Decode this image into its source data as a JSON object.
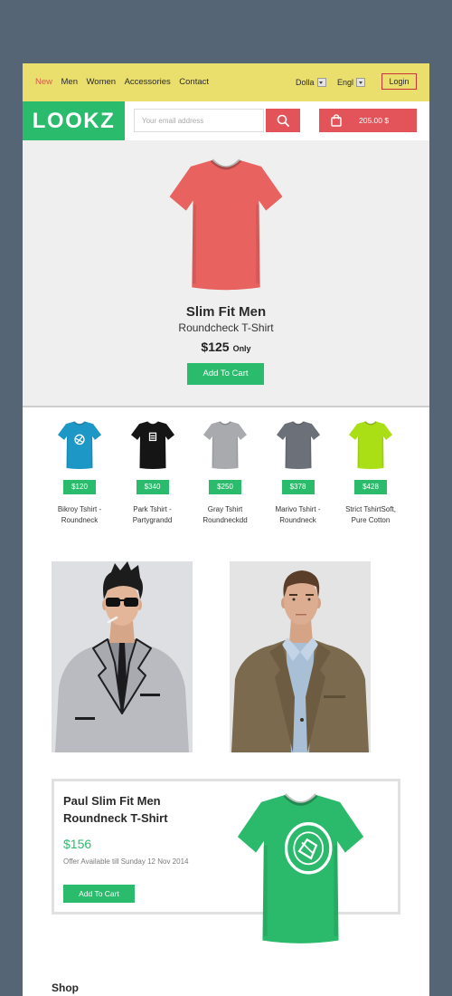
{
  "colors": {
    "page_background": "#566576",
    "nav_background": "#eadf6d",
    "brand_green": "#2bbb6c",
    "accent_red": "#e2535a",
    "nav_active": "#d9574f",
    "hero_background": "#efefef"
  },
  "nav": {
    "items": [
      {
        "label": "New",
        "active": true
      },
      {
        "label": "Men",
        "active": false
      },
      {
        "label": "Women",
        "active": false
      },
      {
        "label": "Accessories",
        "active": false
      },
      {
        "label": "Contact",
        "active": false
      }
    ],
    "currency": {
      "value": "Dolla",
      "icon": "chevron-down-icon"
    },
    "language": {
      "value": "Engl",
      "icon": "chevron-down-icon"
    },
    "login_label": "Login"
  },
  "header": {
    "logo_text": "LOOKZ",
    "email_placeholder": "Your email address",
    "search_icon": "search-icon",
    "cart": {
      "icon": "shopping-bag-icon",
      "total": "205.00 $"
    }
  },
  "hero": {
    "title": "Slim Fit Men",
    "subtitle": "Roundcheck T-Shirt",
    "price": "$125",
    "price_suffix": "Only",
    "button_label": "Add To Cart",
    "shirt_color": "#e8625f"
  },
  "products": [
    {
      "name": "Bikroy Tshirt - Roundneck",
      "price": "$120",
      "color": "#1c97c6"
    },
    {
      "name": "Park Tshirt - Partygrandd",
      "price": "$340",
      "color": "#151515"
    },
    {
      "name": "Gray Tshirt Roundneckdd",
      "price": "$250",
      "color": "#a8aaae"
    },
    {
      "name": "Marivo Tshirt - Roundneck",
      "price": "$378",
      "color": "#6b7079"
    },
    {
      "name": "Strict TshirtSoft, Pure Cotton",
      "price": "$428",
      "color": "#a9df14"
    }
  ],
  "featured": {
    "title_line1": "Paul Slim Fit Men",
    "title_line2": "Roundneck T-Shirt",
    "price": "$156",
    "offer": "Offer Available till Sunday 12 Nov 2014",
    "button_label": "Add To Cart",
    "shirt_color": "#2bb96b"
  },
  "footer": {
    "shop_heading": "Shop"
  }
}
